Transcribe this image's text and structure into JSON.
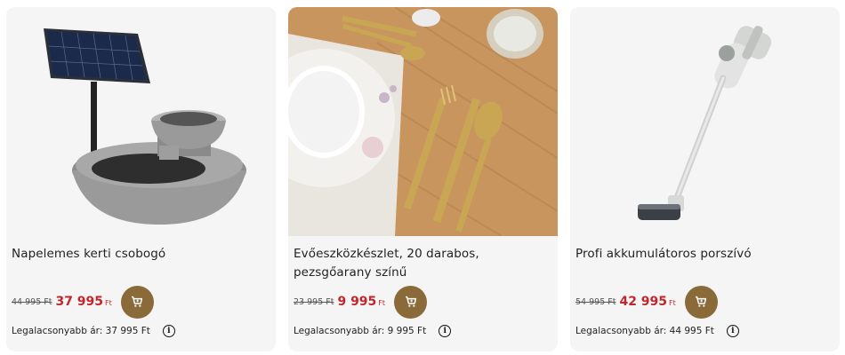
{
  "products": [
    {
      "title": "Napelemes kerti csobogó",
      "old_price": "44 995 Ft",
      "price": "37 995",
      "currency": "Ft",
      "lowest": "Legalacsonyabb ár: 37 995 Ft",
      "image_icon": "solar-fountain-image",
      "cart_icon": "cart-icon",
      "info_icon": "info-icon"
    },
    {
      "title": "Evőeszközkészlet, 20 darabos, pezsgőarany színű",
      "old_price": "23 995 Ft",
      "price": "9 995",
      "currency": "Ft",
      "lowest": "Legalacsonyabb ár: 9 995 Ft",
      "image_icon": "cutlery-set-image",
      "cart_icon": "cart-icon",
      "info_icon": "info-icon"
    },
    {
      "title": "Profi akkumulátoros porszívó",
      "old_price": "54 995 Ft",
      "price": "42 995",
      "currency": "Ft",
      "lowest": "Legalacsonyabb ár: 44 995 Ft",
      "image_icon": "stick-vacuum-image",
      "cart_icon": "cart-icon",
      "info_icon": "info-icon"
    }
  ],
  "colors": {
    "price_red": "#c0272d",
    "cart_button": "#8b6a3a",
    "card_bg": "#f5f5f5"
  }
}
